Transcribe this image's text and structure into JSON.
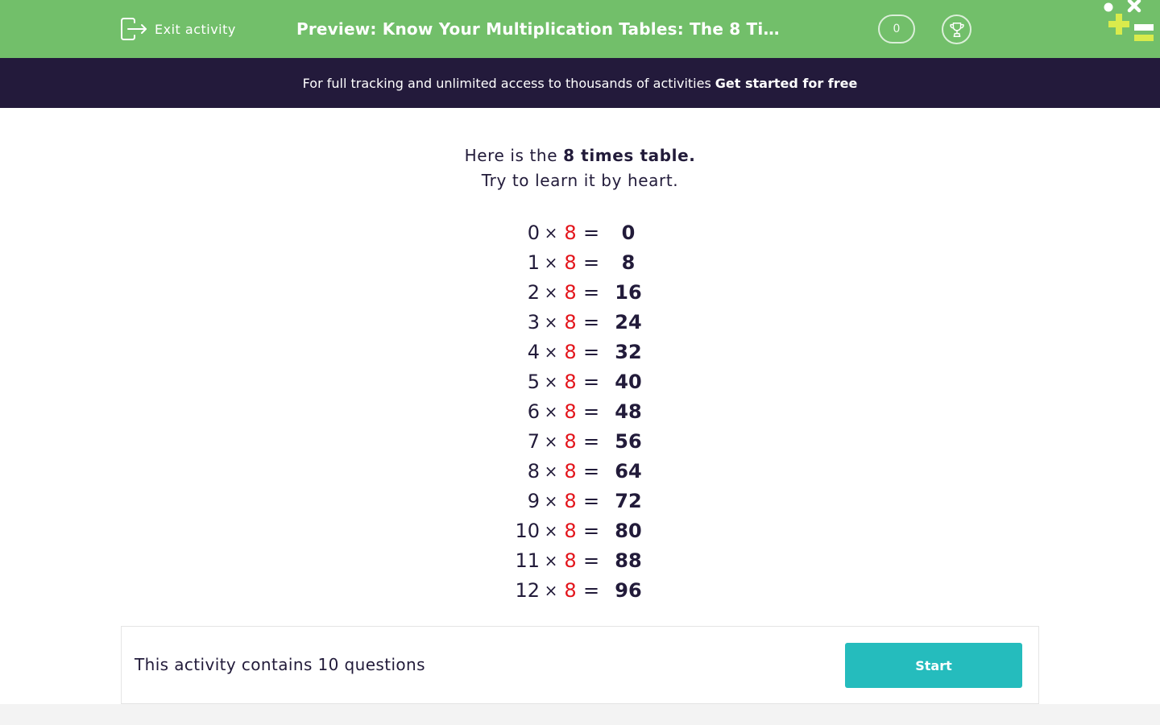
{
  "header": {
    "exit_label": "Exit activity",
    "title": "Preview: Know Your Multiplication Tables: The 8 Times Table",
    "score": "0"
  },
  "banner": {
    "text": "For full tracking and unlimited access to thousands of activities",
    "cta": "Get started for free"
  },
  "intro": {
    "line1_prefix": "Here is the",
    "line1_bold": "8 times table.",
    "line2": "Try to learn it by heart."
  },
  "times_table": {
    "times_sign": "×",
    "equals_sign": "=",
    "rows": [
      {
        "n": "0",
        "m": "8",
        "result": "0"
      },
      {
        "n": "1",
        "m": "8",
        "result": "8"
      },
      {
        "n": "2",
        "m": "8",
        "result": "16"
      },
      {
        "n": "3",
        "m": "8",
        "result": "24"
      },
      {
        "n": "4",
        "m": "8",
        "result": "32"
      },
      {
        "n": "5",
        "m": "8",
        "result": "40"
      },
      {
        "n": "6",
        "m": "8",
        "result": "48"
      },
      {
        "n": "7",
        "m": "8",
        "result": "56"
      },
      {
        "n": "8",
        "m": "8",
        "result": "64"
      },
      {
        "n": "9",
        "m": "8",
        "result": "72"
      },
      {
        "n": "10",
        "m": "8",
        "result": "80"
      },
      {
        "n": "11",
        "m": "8",
        "result": "88"
      },
      {
        "n": "12",
        "m": "8",
        "result": "96"
      }
    ]
  },
  "footer": {
    "info": "This activity contains 10 questions",
    "start_label": "Start"
  },
  "colors": {
    "header_green": "#72bf6a",
    "banner_navy": "#231a3b",
    "highlight_red": "#e3141b",
    "start_teal": "#25bcbd",
    "text_dark": "#221b3a"
  },
  "icons": {
    "exit": "exit-icon",
    "trophy": "trophy-icon",
    "logo": "logo-icon"
  }
}
